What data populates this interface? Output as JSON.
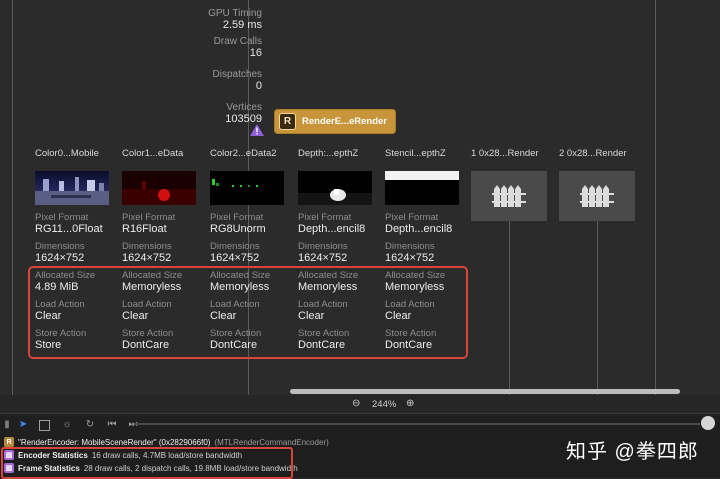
{
  "stats": [
    {
      "label": "GPU Timing",
      "value": "2.59 ms"
    },
    {
      "label": "Draw Calls",
      "value": "16"
    },
    {
      "label": "Dispatches",
      "value": "0"
    },
    {
      "label": "Vertices",
      "value": "103509"
    }
  ],
  "render_node": {
    "badge": "R",
    "label": "RenderE...eRender"
  },
  "attachments": [
    {
      "title": "Color0...Mobile",
      "pixel_format": "RG11...0Float",
      "dimensions": "1624×752",
      "allocated_size": "4.89 MiB",
      "load_action": "Clear",
      "store_action": "Store"
    },
    {
      "title": "Color1...eData",
      "pixel_format": "R16Float",
      "dimensions": "1624×752",
      "allocated_size": "Memoryless",
      "load_action": "Clear",
      "store_action": "DontCare"
    },
    {
      "title": "Color2...eData2",
      "pixel_format": "RG8Unorm",
      "dimensions": "1624×752",
      "allocated_size": "Memoryless",
      "load_action": "Clear",
      "store_action": "DontCare"
    },
    {
      "title": "Depth:...epthZ",
      "pixel_format": "Depth...encil8",
      "dimensions": "1624×752",
      "allocated_size": "Memoryless",
      "load_action": "Clear",
      "store_action": "DontCare"
    },
    {
      "title": "Stencil...epthZ",
      "pixel_format": "Depth...encil8",
      "dimensions": "1624×752",
      "allocated_size": "Memoryless",
      "load_action": "Clear",
      "store_action": "DontCare"
    }
  ],
  "placeholders": [
    {
      "title": "1 0x28...Render"
    },
    {
      "title": "2 0x28...Render"
    }
  ],
  "field_labels": {
    "pixel_format": "Pixel Format",
    "dimensions": "Dimensions",
    "allocated_size": "Allocated Size",
    "load_action": "Load Action",
    "store_action": "Store Action"
  },
  "zoom": {
    "level": "244%"
  },
  "bottom": {
    "encoder_title": "\"RenderEncoder: MobileSceneRender\" (0x2829066f0)",
    "encoder_type": "(MTLRenderCommandEncoder)",
    "encoder_stats_title": "Encoder Statistics",
    "encoder_stats_detail": "16 draw calls, 4.7MB load/store bandwidth",
    "frame_stats_title": "Frame Statistics",
    "frame_stats_detail": "28 draw calls, 2 dispatch calls, 19.8MB load/store bandwidth"
  },
  "watermark": "知乎 @拳四郎",
  "colors": {
    "node": "#c9953a",
    "highlight": "#d9443a",
    "background": "#2b2b2b"
  }
}
